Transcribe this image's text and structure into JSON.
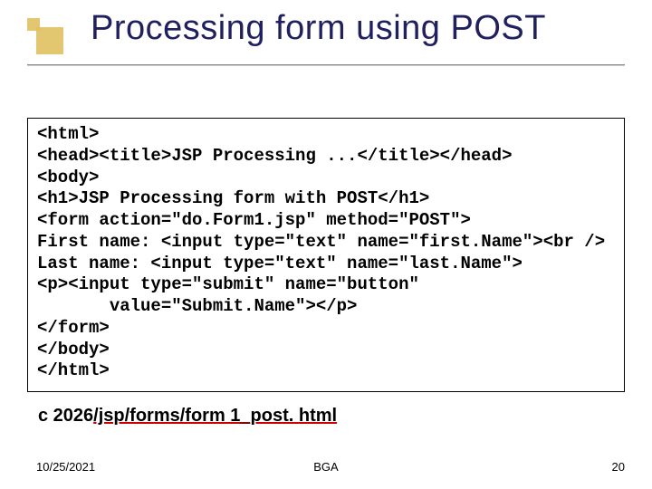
{
  "title": "Processing form using POST",
  "code": "<html>\n<head><title>JSP Processing ...</title></head>\n<body>\n<h1>JSP Processing form with POST</h1>\n<form action=\"do.Form1.jsp\" method=\"POST\">\nFirst name: <input type=\"text\" name=\"first.Name\"><br />\nLast name: <input type=\"text\" name=\"last.Name\">\n<p><input type=\"submit\" name=\"button\"\n       value=\"Submit.Name\"></p>\n</form>\n</body>\n</html>",
  "path_prefix": "c 2026",
  "path_link": "/jsp/forms/form 1_post. html",
  "footer": {
    "date": "10/25/2021",
    "center": "BGA",
    "page": "20"
  }
}
